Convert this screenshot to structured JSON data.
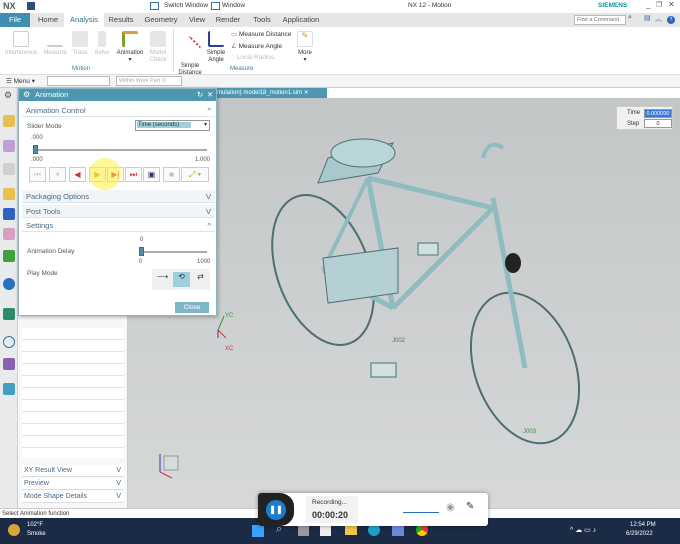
{
  "titlebar": {
    "app": "NX",
    "quick": [
      "Switch Window",
      "Window"
    ],
    "title": "NX 12 - Motion",
    "brand": "SIEMENS"
  },
  "tabs": [
    "File",
    "Home",
    "Analysis",
    "Results",
    "Geometry",
    "View",
    "Render",
    "Tools",
    "Application"
  ],
  "active_tab": "Analysis",
  "find_command": {
    "placeholder": "Find a Command"
  },
  "ribbon": {
    "motion": {
      "label": "Motion",
      "buttons": [
        "Interference",
        "Measure",
        "Trace",
        "Solve",
        "Animation",
        "Model Check"
      ]
    },
    "measure": {
      "label": "Measure",
      "buttons": [
        "Simple Distance",
        "Simple Angle"
      ],
      "small": [
        "Measure Distance",
        "Measure Angle",
        "Local Radius"
      ],
      "more": "More"
    }
  },
  "toolbar": {
    "menu": "Menu",
    "filter": "Within Work Part O"
  },
  "viewport_tab": "mulation) model18_motion1.sim",
  "dialog": {
    "title": "Animation",
    "animation_control": "Animation Control",
    "slider_mode_label": "Slider Mode",
    "slider_mode_value": "Time (seconds)",
    "time_value": ".000",
    "slider_min": ".000",
    "slider_max": "1.000",
    "slider_fraction": 0,
    "packaging": "Packaging Options",
    "post_tools": "Post Tools",
    "settings": "Settings",
    "delay_label": "Animation Delay",
    "delay_value": "0",
    "delay_min": "0",
    "delay_max": "1000",
    "play_mode_label": "Play Mode",
    "close": "Close"
  },
  "nav_sections": [
    "XY Result View",
    "Preview",
    "Mode Shape Details"
  ],
  "readout": {
    "time_label": "Time",
    "time_value": "0.000000",
    "step_label": "Step",
    "step_value": "0"
  },
  "model_labels": [
    "J002",
    "J003"
  ],
  "axes": {
    "y": "YC",
    "x": "XC"
  },
  "status": "Select Animation function",
  "recording": {
    "label": "Recording...",
    "time": "00:00:20"
  },
  "taskbar": {
    "temp": "102°F",
    "weather": "Smoke",
    "time": "12:54 PM",
    "date": "6/29/2022"
  }
}
